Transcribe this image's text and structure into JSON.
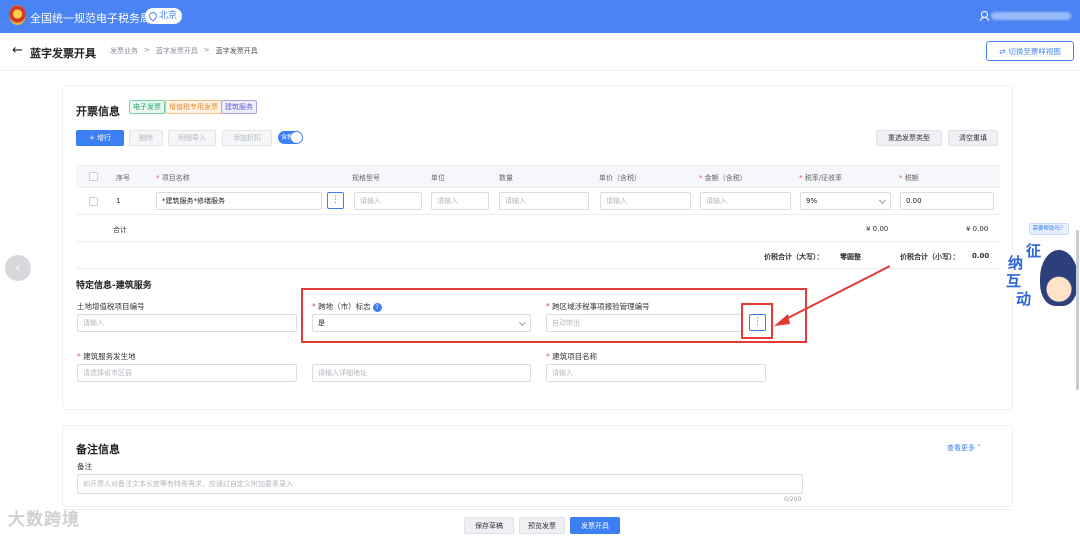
{
  "topbar": {
    "title": "全国统一规范电子税务局",
    "location": "北京"
  },
  "header": {
    "back": "←",
    "title": "蓝字发票开具",
    "breadcrumb": [
      "发票业务",
      ">",
      "蓝字发票开具",
      ">",
      "蓝字发票开具"
    ],
    "switch_label": "切换至票样视图"
  },
  "invoice": {
    "title": "开票信息",
    "tags": [
      "电子发票",
      "增值税专用发票",
      "建筑服务"
    ],
    "toolbar": {
      "add": "+ 增行",
      "delete": "删除",
      "import": "明细导入",
      "discount": "添加折扣",
      "tax_toggle": "含税",
      "reselect": "重选发票类型",
      "clear": "清空重填"
    },
    "columns": [
      {
        "label": "序号",
        "req": ""
      },
      {
        "label": "项目名称",
        "req": "*"
      },
      {
        "label": "规格型号",
        "req": ""
      },
      {
        "label": "单位",
        "req": ""
      },
      {
        "label": "数量",
        "req": ""
      },
      {
        "label": "单价（含税）",
        "req": ""
      },
      {
        "label": "金额（含税）",
        "req": "*"
      },
      {
        "label": "税率/征收率",
        "req": "*"
      },
      {
        "label": "税额",
        "req": "*"
      }
    ],
    "row": {
      "index": "1",
      "item": "*建筑服务*修缮服务",
      "dots": "⋮",
      "spec_ph": "请输入",
      "unit_ph": "请输入",
      "qty_ph": "请输入",
      "price_ph": "请输入",
      "amount_ph": "请输入",
      "rate": "9%",
      "tax": "0.00"
    },
    "subtotal": {
      "label": "合计",
      "amount": "¥ 0.00",
      "tax": "¥ 0.00"
    },
    "total_upper_label": "价税合计（大写）：",
    "total_upper": "零圆整",
    "total_lower_label": "价税合计（小写）：",
    "total_lower": "0.00"
  },
  "special": {
    "title": "特定信息-建筑服务",
    "land_label": "土地增值税项目编号",
    "land_ph": "请输入",
    "cross_req": "*",
    "cross_label": "跨地（市）标志",
    "cross_help": "?",
    "cross_value": "是",
    "report_req": "*",
    "report_label": "跨区域涉税事项报验管理编号",
    "report_ph": "自动带出",
    "report_dots": "⋮",
    "site_req": "*",
    "site_label": "建筑服务发生地",
    "site_ph_region": "请选择省市区县",
    "site_ph_addr": "请输入详细地址",
    "proj_req": "*",
    "proj_label": "建筑项目名称",
    "proj_ph": "请输入"
  },
  "remarks": {
    "title": "备注信息",
    "more": "查看更多",
    "field_label": "备注",
    "placeholder": "如开票人对备注文本长度等有特殊需求，应通过自定义附加要素录入",
    "count": "0/200"
  },
  "footer": {
    "save": "保存草稿",
    "preview": "预览发票",
    "issue": "发票开具"
  },
  "side": {
    "tip": "需要帮助吗？",
    "widget_chars": [
      "征",
      "纳",
      "互",
      "动"
    ]
  },
  "watermark": "大数跨境",
  "colors": {
    "primary": "#3b7ff2",
    "topbar": "#4a84f4",
    "annotation_red": "#e33b35"
  }
}
